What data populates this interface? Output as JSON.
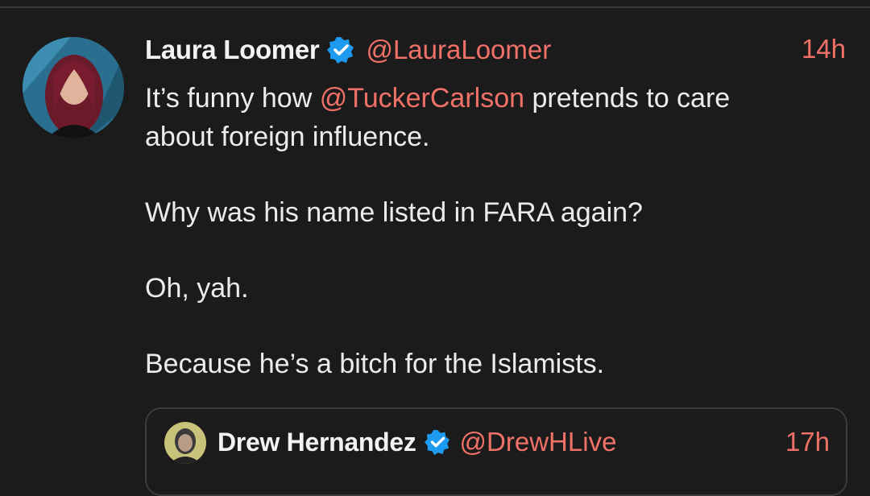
{
  "tweet": {
    "author_name": "Laura Loomer",
    "handle": "@LauraLoomer",
    "time": "14h",
    "line1_pre": "It’s funny how ",
    "mention": "@TuckerCarlson",
    "line1_post": " pretends to care",
    "line2": "about foreign influence.",
    "para2": "Why was his name listed in FARA again?",
    "para3": "Oh, yah.",
    "para4": "Because he’s a bitch for the Islamists."
  },
  "quoted": {
    "author_name": "Drew Hernandez",
    "handle": "@DrewHLive",
    "time": "17h"
  },
  "colors": {
    "background": "#1b1b1b",
    "accent": "#f07167",
    "verified": "#1d9bf0"
  },
  "icons": {
    "verified": "verified-badge-icon"
  }
}
